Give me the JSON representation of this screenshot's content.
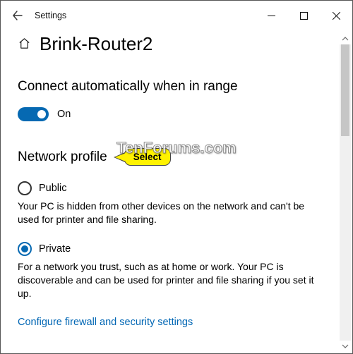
{
  "window": {
    "title": "Settings"
  },
  "page": {
    "title": "Brink-Router2"
  },
  "auto_connect": {
    "heading": "Connect automatically when in range",
    "state_label": "On",
    "enabled": true
  },
  "annotation": {
    "label": "Select"
  },
  "network_profile": {
    "heading": "Network profile",
    "options": [
      {
        "label": "Public",
        "description": "Your PC is hidden from other devices on the network and can't be used for printer and file sharing.",
        "selected": false
      },
      {
        "label": "Private",
        "description": "For a network you trust, such as at home or work. Your PC is discoverable and can be used for printer and file sharing if you set it up.",
        "selected": true
      }
    ]
  },
  "link": {
    "firewall": "Configure firewall and security settings"
  },
  "watermark": "TenForums.com"
}
